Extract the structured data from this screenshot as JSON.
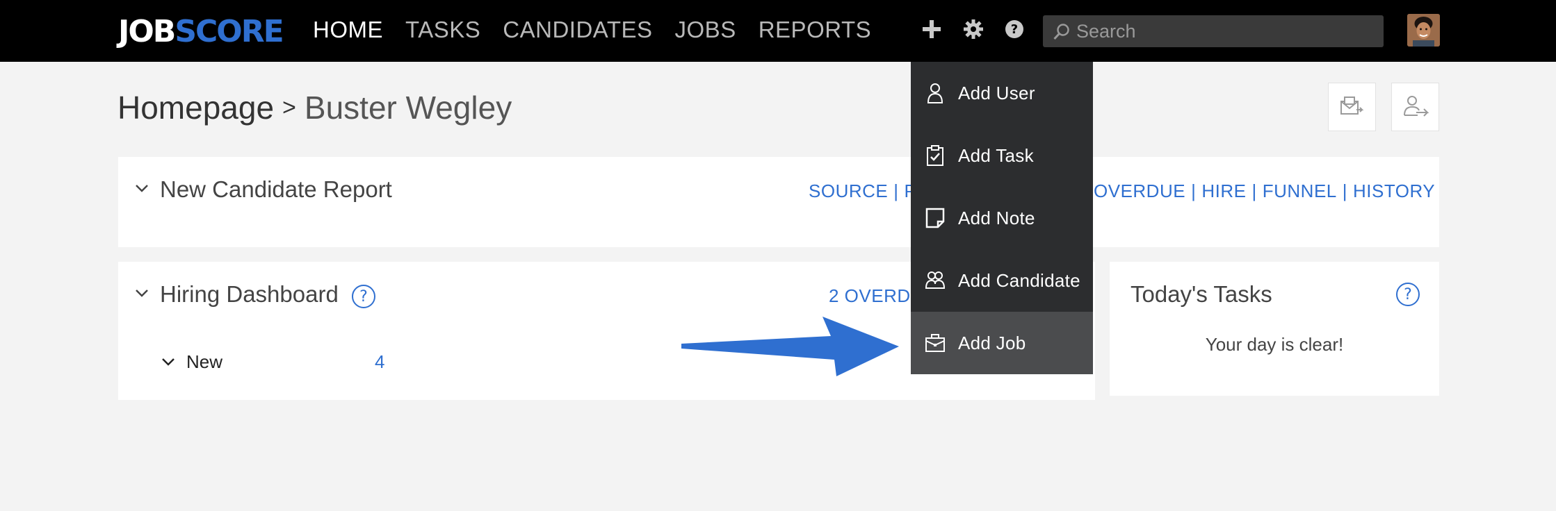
{
  "brand": {
    "logo_part1": "JOB",
    "logo_part2": "SCORE"
  },
  "nav": {
    "items": [
      {
        "label": "HOME",
        "active": true
      },
      {
        "label": "TASKS"
      },
      {
        "label": "CANDIDATES"
      },
      {
        "label": "JOBS"
      },
      {
        "label": "REPORTS"
      }
    ]
  },
  "toolbar": {
    "icons": [
      "plus-icon",
      "gear-icon",
      "help-icon"
    ],
    "search_placeholder": "Search"
  },
  "header": {
    "breadcrumb_root": "Homepage",
    "breadcrumb_separator": ">",
    "breadcrumb_current": "Buster Wegley",
    "action_icons": [
      "email-tray-icon",
      "person-arrow-icon"
    ]
  },
  "new_candidate_report": {
    "title": "New Candidate Report",
    "links_left": [
      "SOURCE",
      "P"
    ],
    "links_right": [
      "OVERDUE",
      "HIRE",
      "FUNNEL",
      "HISTORY"
    ],
    "separator": "|"
  },
  "hiring_dashboard": {
    "title": "Hiring Dashboard",
    "help": "?",
    "overdue_link": "2 OVERD",
    "rows": [
      {
        "label": "New",
        "count": "4"
      }
    ]
  },
  "todays_tasks": {
    "title": "Today's Tasks",
    "help": "?",
    "message": "Your day is clear!"
  },
  "add_menu": {
    "items": [
      {
        "label": "Add User",
        "icon": "user-icon"
      },
      {
        "label": "Add Task",
        "icon": "clipboard-check-icon"
      },
      {
        "label": "Add Note",
        "icon": "note-icon"
      },
      {
        "label": "Add Candidate",
        "icon": "candidates-icon"
      },
      {
        "label": "Add Job",
        "icon": "briefcase-icon",
        "highlighted": true
      }
    ]
  },
  "colors": {
    "accent": "#2f6fd0",
    "topbar": "#000000",
    "menu_bg": "#2c2d2f",
    "menu_hover": "#4b4c4e",
    "arrow": "#2f6fd0"
  }
}
